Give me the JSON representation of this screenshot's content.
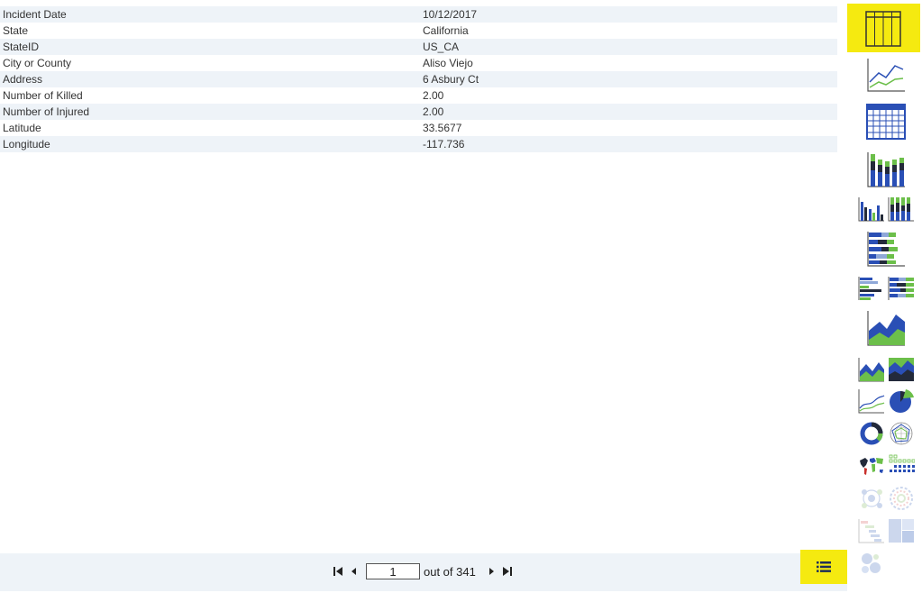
{
  "record": {
    "rows": [
      {
        "label": "Incident Date",
        "value": "10/12/2017"
      },
      {
        "label": "State",
        "value": "California"
      },
      {
        "label": "StateID",
        "value": "US_CA"
      },
      {
        "label": "City or County",
        "value": "Aliso Viejo"
      },
      {
        "label": "Address",
        "value": "6 Asbury Ct"
      },
      {
        "label": "Number of Killed",
        "value": "2.00"
      },
      {
        "label": "Number of Injured",
        "value": "2.00"
      },
      {
        "label": "Latitude",
        "value": "33.5677"
      },
      {
        "label": "Longitude",
        "value": "-117.736"
      }
    ]
  },
  "pager": {
    "current_page": "1",
    "out_of_text": "out of 341"
  },
  "sidebar": {
    "selected": "table-view",
    "items": [
      {
        "name": "table-view",
        "icon": "table-icon"
      },
      {
        "name": "line-chart",
        "icon": "line-chart-icon"
      },
      {
        "name": "grid-view",
        "icon": "grid-icon"
      },
      {
        "name": "stacked-column",
        "icon": "stacked-column-icon"
      },
      {
        "name": "clustered-column",
        "icon": "clustered-column-icon"
      },
      {
        "name": "stacked-column-100",
        "icon": "stacked-column-100-icon"
      },
      {
        "name": "stacked-bar",
        "icon": "stacked-bar-icon"
      },
      {
        "name": "clustered-bar",
        "icon": "clustered-bar-icon"
      },
      {
        "name": "stacked-bar-100",
        "icon": "stacked-bar-100-icon"
      },
      {
        "name": "area-chart",
        "icon": "area-chart-icon"
      },
      {
        "name": "stacked-area",
        "icon": "stacked-area-icon"
      },
      {
        "name": "stacked-area-100",
        "icon": "stacked-area-100-icon"
      },
      {
        "name": "spline-chart",
        "icon": "spline-chart-icon"
      },
      {
        "name": "pie-chart",
        "icon": "pie-chart-icon"
      },
      {
        "name": "donut-chart",
        "icon": "donut-chart-icon"
      },
      {
        "name": "radar-chart",
        "icon": "radar-chart-icon"
      },
      {
        "name": "world-map",
        "icon": "world-map-icon"
      },
      {
        "name": "dot-matrix",
        "icon": "dot-matrix-icon"
      },
      {
        "name": "cluster-chart",
        "icon": "cluster-chart-icon"
      },
      {
        "name": "radial-chart",
        "icon": "radial-chart-icon"
      },
      {
        "name": "gantt-chart",
        "icon": "gantt-chart-icon"
      },
      {
        "name": "treemap",
        "icon": "treemap-icon"
      },
      {
        "name": "bubble-chart",
        "icon": "bubble-chart-icon"
      }
    ]
  },
  "colors": {
    "accent_yellow": "#f5ea10",
    "chart_blue": "#2a4fb5",
    "chart_green": "#6cbf4a",
    "chart_dark": "#232a3a",
    "row_stripe": "#eef3f8"
  }
}
